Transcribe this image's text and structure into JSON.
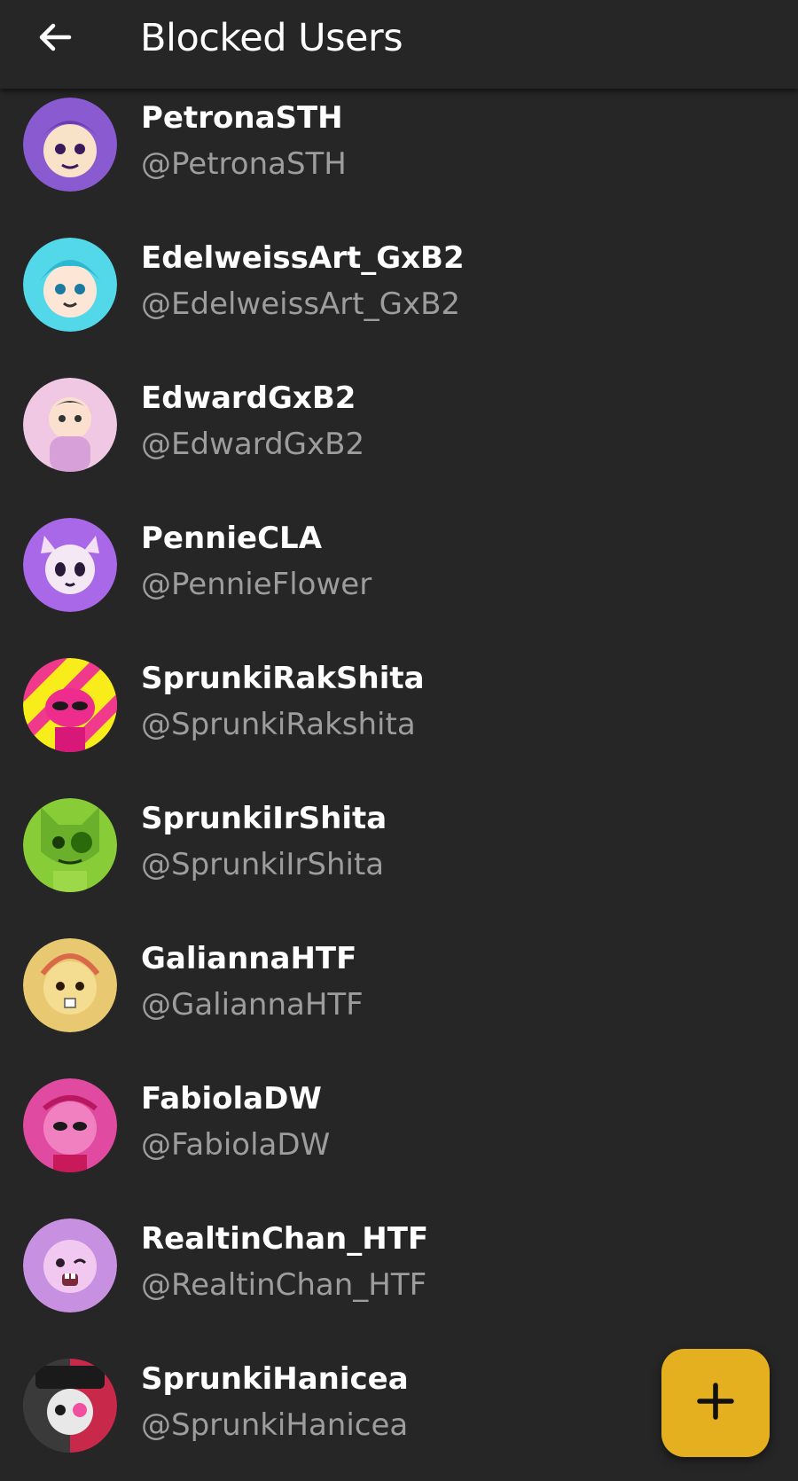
{
  "header": {
    "title": "Blocked Users",
    "back_icon": "arrow-back-icon"
  },
  "colors": {
    "background": "#262626",
    "handle_text": "#9d9d9d",
    "fab": "#e4b020"
  },
  "users": [
    {
      "name": "PetronaSTH",
      "handle": "@PetronaSTH",
      "avatar_color": "#8a5ad0"
    },
    {
      "name": "EdelweissArt_GxB2",
      "handle": "@EdelweissArt_GxB2",
      "avatar_color": "#52d8e8"
    },
    {
      "name": "EdwardGxB2",
      "handle": "@EdwardGxB2",
      "avatar_color": "#f0c8e4"
    },
    {
      "name": "PennieCLA",
      "handle": "@PennieFlower",
      "avatar_color": "#a868e8"
    },
    {
      "name": "SprunkiRakShita",
      "handle": "@SprunkiRakshita",
      "avatar_color": "#f8ec1a"
    },
    {
      "name": "SprunkiIrShita",
      "handle": "@SprunkiIrShita",
      "avatar_color": "#88cc38"
    },
    {
      "name": "GaliannaHTF",
      "handle": "@GaliannaHTF",
      "avatar_color": "#e8c870"
    },
    {
      "name": "FabiolaDW",
      "handle": "@FabiolaDW",
      "avatar_color": "#e04aa0"
    },
    {
      "name": "RealtinChan_HTF",
      "handle": "@RealtinChan_HTF",
      "avatar_color": "#c890e0"
    },
    {
      "name": "SprunkiHanicea",
      "handle": "@SprunkiHanicea",
      "avatar_color": "#c8284a"
    }
  ],
  "fab": {
    "icon": "plus-icon"
  }
}
